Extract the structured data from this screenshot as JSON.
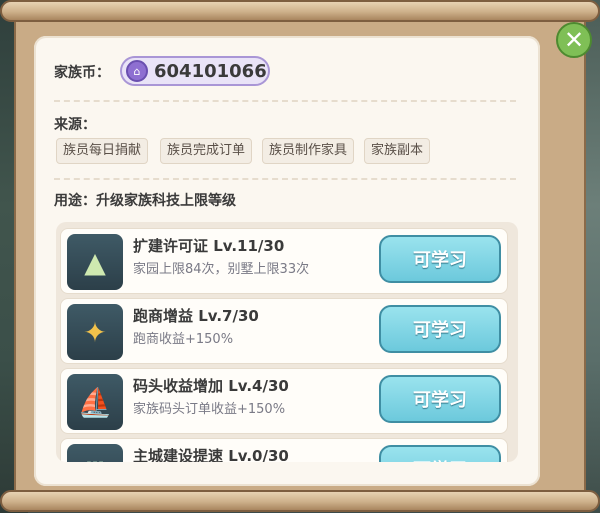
{
  "currency": {
    "label": "家族币：",
    "value": "604101066",
    "icon": "clan-coin-icon"
  },
  "source": {
    "label": "来源：",
    "tags": [
      "族员每日捐献",
      "族员完成订单",
      "族员制作家具",
      "家族副本"
    ]
  },
  "usage": {
    "text": "用途：升级家族科技上限等级"
  },
  "techs": [
    {
      "title": "扩建许可证 Lv.11/30",
      "desc": "家园上限84次，别墅上限33次",
      "button": "可学习",
      "icon": "floating-island-icon"
    },
    {
      "title": "跑商增益 Lv.7/30",
      "desc": "跑商收益+150%",
      "button": "可学习",
      "icon": "running-courier-icon"
    },
    {
      "title": "码头收益增加 Lv.4/30",
      "desc": "家族码头订单收益+150%",
      "button": "可学习",
      "icon": "airship-icon"
    },
    {
      "title": "主城建设提速 Lv.0/30",
      "desc": "",
      "button": "可学习",
      "icon": "castle-icon"
    }
  ],
  "close": {
    "icon": "close-icon",
    "glyph": "✕"
  }
}
